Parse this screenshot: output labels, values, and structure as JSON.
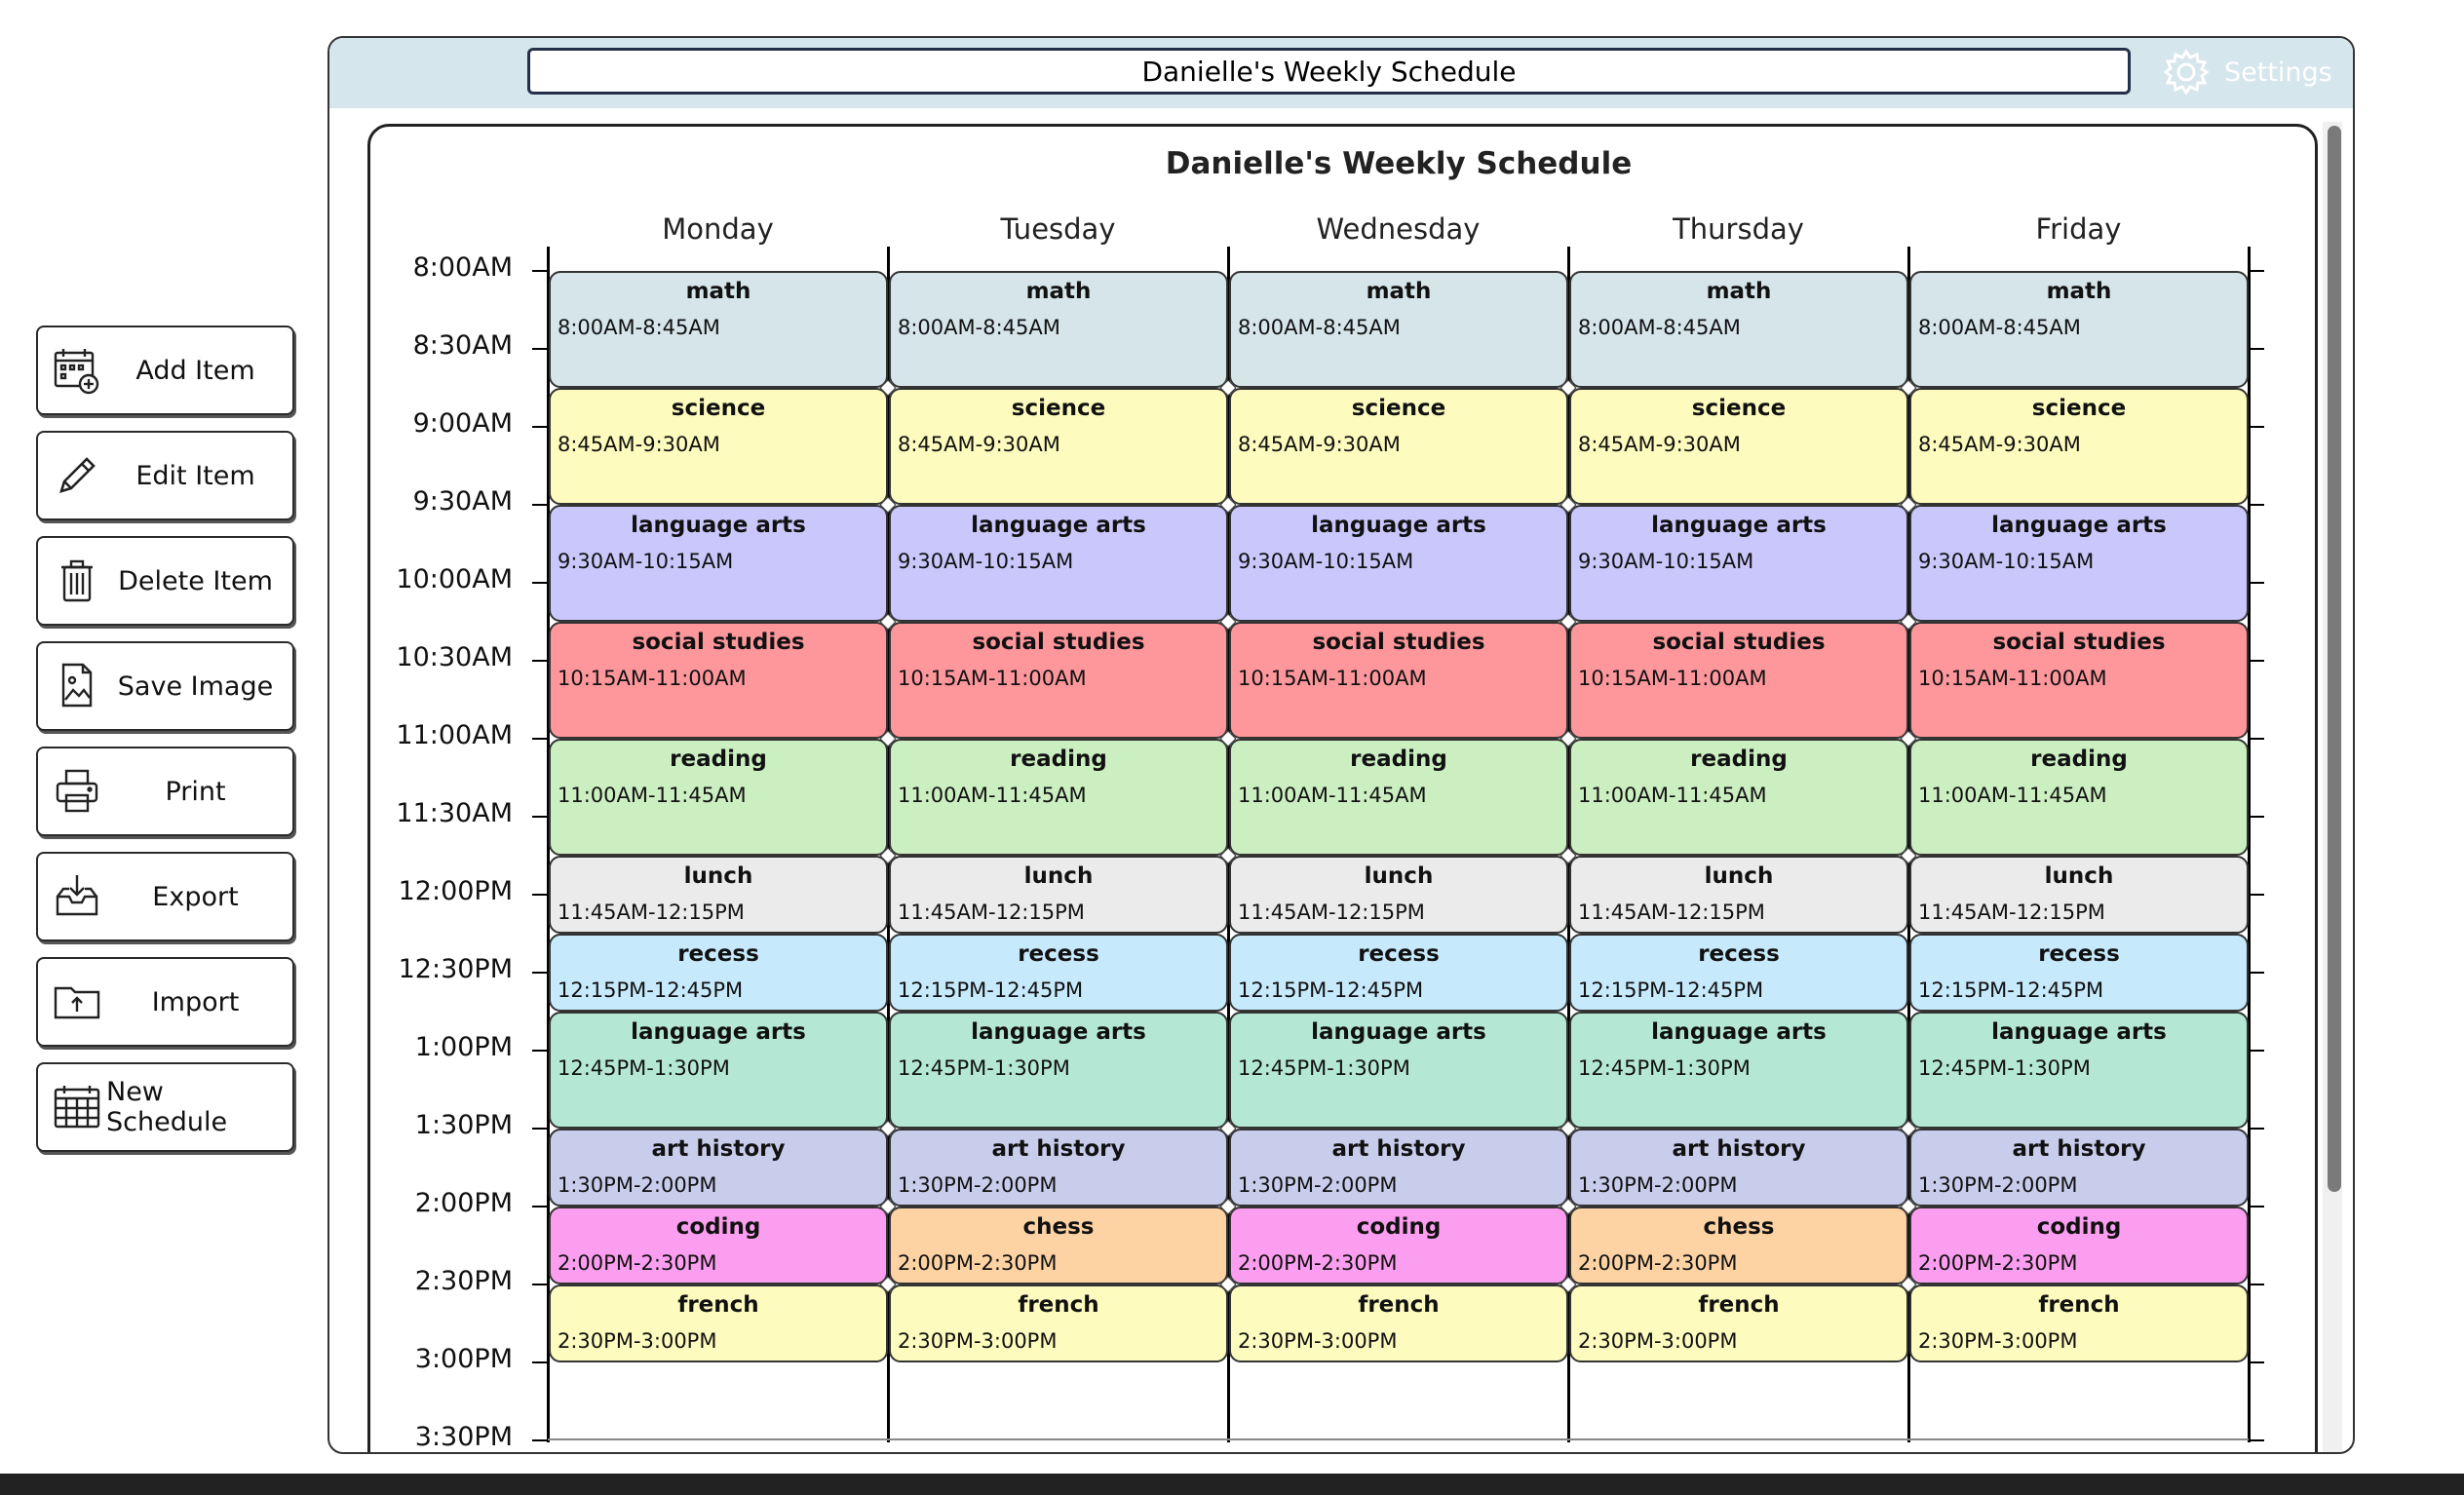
{
  "sidebar": {
    "add": "Add Item",
    "edit": "Edit Item",
    "delete": "Delete Item",
    "save_image": "Save Image",
    "print": "Print",
    "export": "Export",
    "import": "Import",
    "new_schedule": "New Schedule"
  },
  "header": {
    "title_value": "Danielle's Weekly Schedule",
    "settings": "Settings"
  },
  "schedule": {
    "title": "Danielle's Weekly Schedule",
    "days": [
      "Monday",
      "Tuesday",
      "Wednesday",
      "Thursday",
      "Friday"
    ],
    "times": [
      "8:00AM",
      "8:30AM",
      "9:00AM",
      "9:30AM",
      "10:00AM",
      "10:30AM",
      "11:00AM",
      "11:30AM",
      "12:00PM",
      "12:30PM",
      "1:00PM",
      "1:30PM",
      "2:00PM",
      "2:30PM",
      "3:00PM",
      "3:30PM"
    ],
    "events": [
      {
        "day": 0,
        "name": "math",
        "time": "8:00AM-8:45AM",
        "start": 0,
        "end": 45,
        "color": "#d5e5ea"
      },
      {
        "day": 1,
        "name": "math",
        "time": "8:00AM-8:45AM",
        "start": 0,
        "end": 45,
        "color": "#d5e5ea"
      },
      {
        "day": 2,
        "name": "math",
        "time": "8:00AM-8:45AM",
        "start": 0,
        "end": 45,
        "color": "#d5e5ea"
      },
      {
        "day": 3,
        "name": "math",
        "time": "8:00AM-8:45AM",
        "start": 0,
        "end": 45,
        "color": "#d5e5ea"
      },
      {
        "day": 4,
        "name": "math",
        "time": "8:00AM-8:45AM",
        "start": 0,
        "end": 45,
        "color": "#d5e5ea"
      },
      {
        "day": 0,
        "name": "science",
        "time": "8:45AM-9:30AM",
        "start": 45,
        "end": 90,
        "color": "#fdfbbd"
      },
      {
        "day": 1,
        "name": "science",
        "time": "8:45AM-9:30AM",
        "start": 45,
        "end": 90,
        "color": "#fdfbbd"
      },
      {
        "day": 2,
        "name": "science",
        "time": "8:45AM-9:30AM",
        "start": 45,
        "end": 90,
        "color": "#fdfbbd"
      },
      {
        "day": 3,
        "name": "science",
        "time": "8:45AM-9:30AM",
        "start": 45,
        "end": 90,
        "color": "#fdfbbd"
      },
      {
        "day": 4,
        "name": "science",
        "time": "8:45AM-9:30AM",
        "start": 45,
        "end": 90,
        "color": "#fdfbbd"
      },
      {
        "day": 0,
        "name": "language arts",
        "time": "9:30AM-10:15AM",
        "start": 90,
        "end": 135,
        "color": "#cac7fc"
      },
      {
        "day": 1,
        "name": "language arts",
        "time": "9:30AM-10:15AM",
        "start": 90,
        "end": 135,
        "color": "#cac7fc"
      },
      {
        "day": 2,
        "name": "language arts",
        "time": "9:30AM-10:15AM",
        "start": 90,
        "end": 135,
        "color": "#cac7fc"
      },
      {
        "day": 3,
        "name": "language arts",
        "time": "9:30AM-10:15AM",
        "start": 90,
        "end": 135,
        "color": "#cac7fc"
      },
      {
        "day": 4,
        "name": "language arts",
        "time": "9:30AM-10:15AM",
        "start": 90,
        "end": 135,
        "color": "#cac7fc"
      },
      {
        "day": 0,
        "name": "social studies",
        "time": "10:15AM-11:00AM",
        "start": 135,
        "end": 180,
        "color": "#fd979c"
      },
      {
        "day": 1,
        "name": "social studies",
        "time": "10:15AM-11:00AM",
        "start": 135,
        "end": 180,
        "color": "#fd979c"
      },
      {
        "day": 2,
        "name": "social studies",
        "time": "10:15AM-11:00AM",
        "start": 135,
        "end": 180,
        "color": "#fd979c"
      },
      {
        "day": 3,
        "name": "social studies",
        "time": "10:15AM-11:00AM",
        "start": 135,
        "end": 180,
        "color": "#fd979c"
      },
      {
        "day": 4,
        "name": "social studies",
        "time": "10:15AM-11:00AM",
        "start": 135,
        "end": 180,
        "color": "#fd979c"
      },
      {
        "day": 0,
        "name": "reading",
        "time": "11:00AM-11:45AM",
        "start": 180,
        "end": 225,
        "color": "#ccefc1"
      },
      {
        "day": 1,
        "name": "reading",
        "time": "11:00AM-11:45AM",
        "start": 180,
        "end": 225,
        "color": "#ccefc1"
      },
      {
        "day": 2,
        "name": "reading",
        "time": "11:00AM-11:45AM",
        "start": 180,
        "end": 225,
        "color": "#ccefc1"
      },
      {
        "day": 3,
        "name": "reading",
        "time": "11:00AM-11:45AM",
        "start": 180,
        "end": 225,
        "color": "#ccefc1"
      },
      {
        "day": 4,
        "name": "reading",
        "time": "11:00AM-11:45AM",
        "start": 180,
        "end": 225,
        "color": "#ccefc1"
      },
      {
        "day": 0,
        "name": "lunch",
        "time": "11:45AM-12:15PM",
        "start": 225,
        "end": 255,
        "color": "#ebebeb"
      },
      {
        "day": 1,
        "name": "lunch",
        "time": "11:45AM-12:15PM",
        "start": 225,
        "end": 255,
        "color": "#ebebeb"
      },
      {
        "day": 2,
        "name": "lunch",
        "time": "11:45AM-12:15PM",
        "start": 225,
        "end": 255,
        "color": "#ebebeb"
      },
      {
        "day": 3,
        "name": "lunch",
        "time": "11:45AM-12:15PM",
        "start": 225,
        "end": 255,
        "color": "#ebebeb"
      },
      {
        "day": 4,
        "name": "lunch",
        "time": "11:45AM-12:15PM",
        "start": 225,
        "end": 255,
        "color": "#ebebeb"
      },
      {
        "day": 0,
        "name": "recess",
        "time": "12:15PM-12:45PM",
        "start": 255,
        "end": 285,
        "color": "#c6eafc"
      },
      {
        "day": 1,
        "name": "recess",
        "time": "12:15PM-12:45PM",
        "start": 255,
        "end": 285,
        "color": "#c6eafc"
      },
      {
        "day": 2,
        "name": "recess",
        "time": "12:15PM-12:45PM",
        "start": 255,
        "end": 285,
        "color": "#c6eafc"
      },
      {
        "day": 3,
        "name": "recess",
        "time": "12:15PM-12:45PM",
        "start": 255,
        "end": 285,
        "color": "#c6eafc"
      },
      {
        "day": 4,
        "name": "recess",
        "time": "12:15PM-12:45PM",
        "start": 255,
        "end": 285,
        "color": "#c6eafc"
      },
      {
        "day": 0,
        "name": "language arts",
        "time": "12:45PM-1:30PM",
        "start": 285,
        "end": 330,
        "color": "#b4e8d5"
      },
      {
        "day": 1,
        "name": "language arts",
        "time": "12:45PM-1:30PM",
        "start": 285,
        "end": 330,
        "color": "#b4e8d5"
      },
      {
        "day": 2,
        "name": "language arts",
        "time": "12:45PM-1:30PM",
        "start": 285,
        "end": 330,
        "color": "#b4e8d5"
      },
      {
        "day": 3,
        "name": "language arts",
        "time": "12:45PM-1:30PM",
        "start": 285,
        "end": 330,
        "color": "#b4e8d5"
      },
      {
        "day": 4,
        "name": "language arts",
        "time": "12:45PM-1:30PM",
        "start": 285,
        "end": 330,
        "color": "#b4e8d5"
      },
      {
        "day": 0,
        "name": "art history",
        "time": "1:30PM-2:00PM",
        "start": 330,
        "end": 360,
        "color": "#c9cdec"
      },
      {
        "day": 1,
        "name": "art history",
        "time": "1:30PM-2:00PM",
        "start": 330,
        "end": 360,
        "color": "#c9cdec"
      },
      {
        "day": 2,
        "name": "art history",
        "time": "1:30PM-2:00PM",
        "start": 330,
        "end": 360,
        "color": "#c9cdec"
      },
      {
        "day": 3,
        "name": "art history",
        "time": "1:30PM-2:00PM",
        "start": 330,
        "end": 360,
        "color": "#c9cdec"
      },
      {
        "day": 4,
        "name": "art history",
        "time": "1:30PM-2:00PM",
        "start": 330,
        "end": 360,
        "color": "#c9cdec"
      },
      {
        "day": 0,
        "name": "coding",
        "time": "2:00PM-2:30PM",
        "start": 360,
        "end": 390,
        "color": "#fc9ef0"
      },
      {
        "day": 1,
        "name": "chess",
        "time": "2:00PM-2:30PM",
        "start": 360,
        "end": 390,
        "color": "#fdd3a4"
      },
      {
        "day": 2,
        "name": "coding",
        "time": "2:00PM-2:30PM",
        "start": 360,
        "end": 390,
        "color": "#fc9ef0"
      },
      {
        "day": 3,
        "name": "chess",
        "time": "2:00PM-2:30PM",
        "start": 360,
        "end": 390,
        "color": "#fdd3a4"
      },
      {
        "day": 4,
        "name": "coding",
        "time": "2:00PM-2:30PM",
        "start": 360,
        "end": 390,
        "color": "#fc9ef0"
      },
      {
        "day": 0,
        "name": "french",
        "time": "2:30PM-3:00PM",
        "start": 390,
        "end": 420,
        "color": "#fdfbbd"
      },
      {
        "day": 1,
        "name": "french",
        "time": "2:30PM-3:00PM",
        "start": 390,
        "end": 420,
        "color": "#fdfbbd"
      },
      {
        "day": 2,
        "name": "french",
        "time": "2:30PM-3:00PM",
        "start": 390,
        "end": 420,
        "color": "#fdfbbd"
      },
      {
        "day": 3,
        "name": "french",
        "time": "2:30PM-3:00PM",
        "start": 390,
        "end": 420,
        "color": "#fdfbbd"
      },
      {
        "day": 4,
        "name": "french",
        "time": "2:30PM-3:00PM",
        "start": 390,
        "end": 420,
        "color": "#fdfbbd"
      }
    ]
  }
}
